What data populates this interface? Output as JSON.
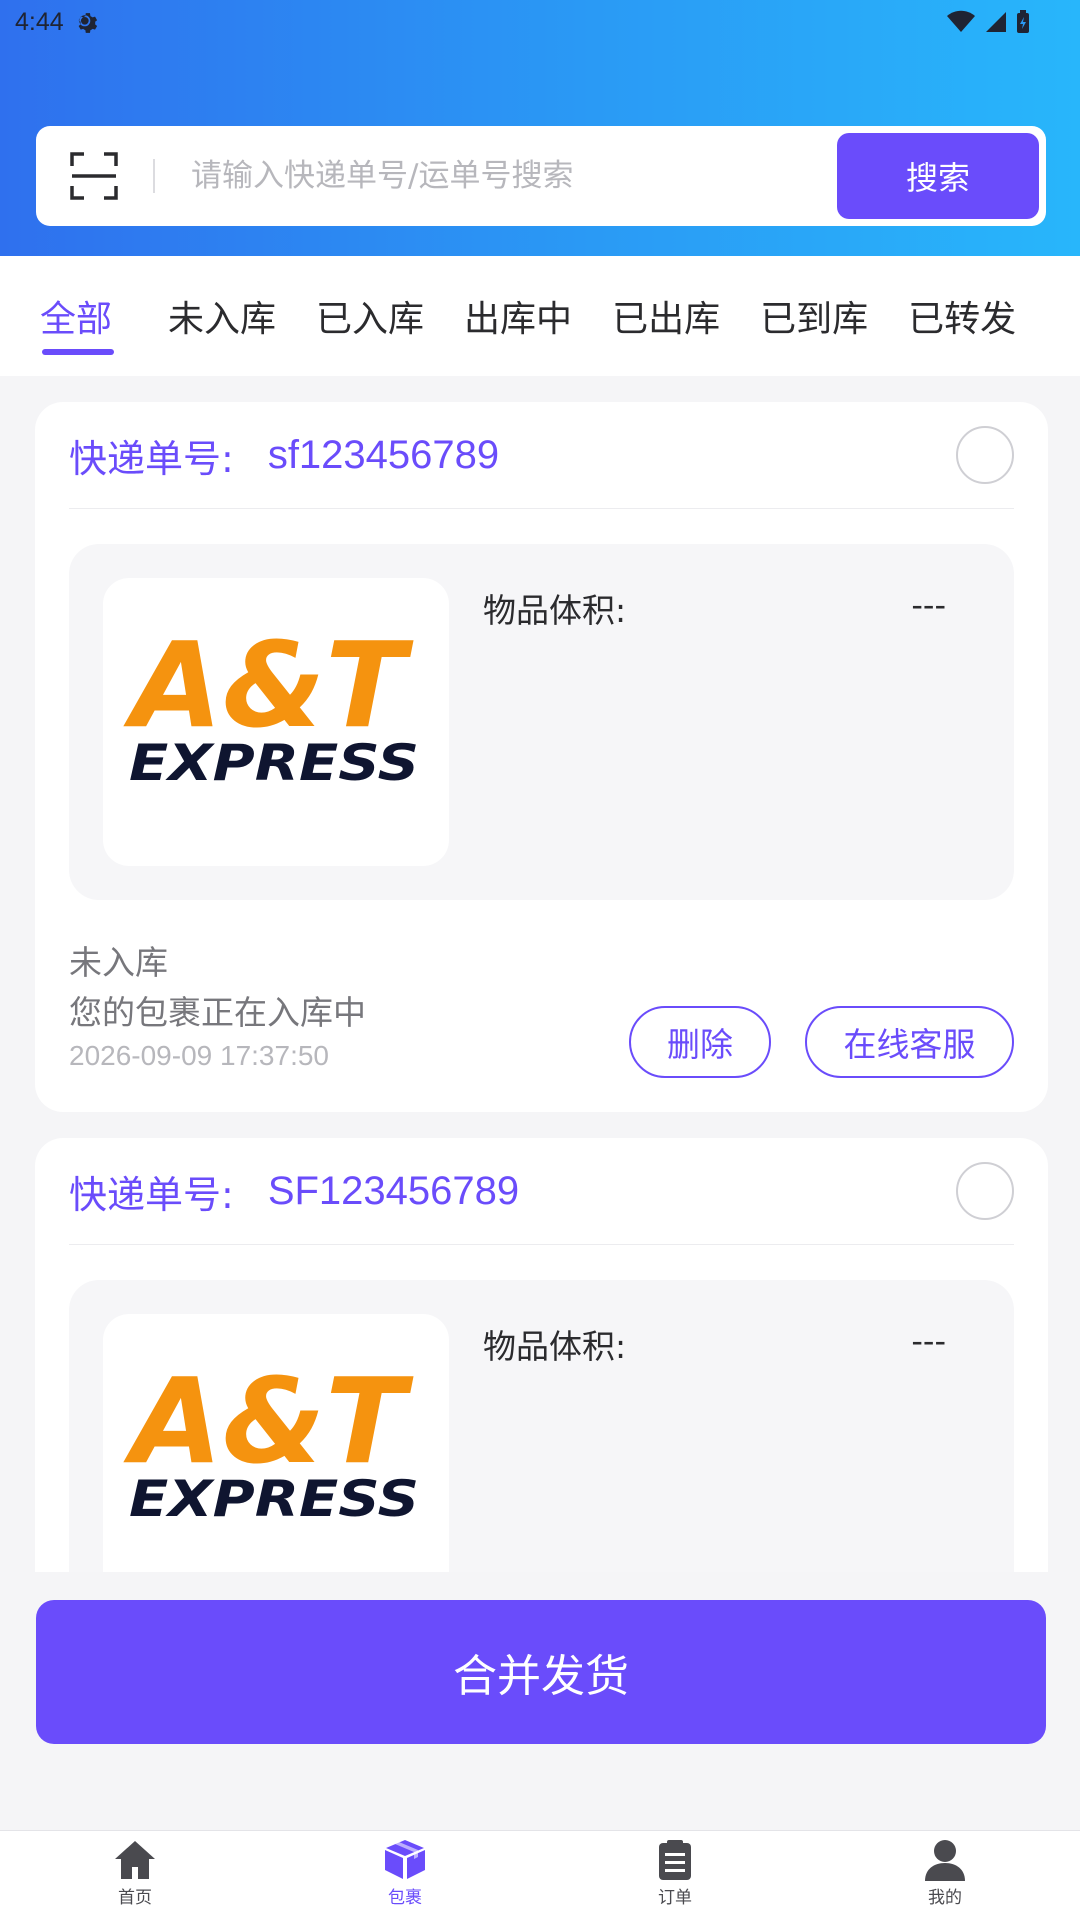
{
  "status_bar": {
    "time": "4:44"
  },
  "search": {
    "placeholder": "请输入快递单号/运单号搜索",
    "button_label": "搜索"
  },
  "tabs": [
    {
      "label": "全部",
      "active": true
    },
    {
      "label": "未入库",
      "active": false
    },
    {
      "label": "已入库",
      "active": false
    },
    {
      "label": "出库中",
      "active": false
    },
    {
      "label": "已出库",
      "active": false
    },
    {
      "label": "已到库",
      "active": false
    },
    {
      "label": "已转发",
      "active": false
    }
  ],
  "packages": [
    {
      "waybill_label": "快递单号:",
      "waybill_no": "sf123456789",
      "volume_label": "物品体积:",
      "volume_value": "---",
      "logo": {
        "line1": "A&T",
        "line2": "EXPRESS"
      },
      "status_title": "未入库",
      "status_desc": "您的包裹正在入库中",
      "time": "2026-09-09 17:37:50",
      "delete_label": "删除",
      "service_label": "在线客服"
    },
    {
      "waybill_label": "快递单号:",
      "waybill_no": "SF123456789",
      "volume_label": "物品体积:",
      "volume_value": "---",
      "logo": {
        "line1": "A&T",
        "line2": "EXPRESS"
      }
    }
  ],
  "merge_button": "合并发货",
  "nav": [
    {
      "label": "首页",
      "icon": "home-icon",
      "active": false
    },
    {
      "label": "包裹",
      "icon": "package-icon",
      "active": true
    },
    {
      "label": "订单",
      "icon": "order-icon",
      "active": false
    },
    {
      "label": "我的",
      "icon": "user-icon",
      "active": false
    }
  ],
  "colors": {
    "accent": "#6a4cfb",
    "header_start": "#2f70ee",
    "header_end": "#28b6fb",
    "logo_orange": "#f5930f",
    "logo_navy": "#0f1530"
  }
}
